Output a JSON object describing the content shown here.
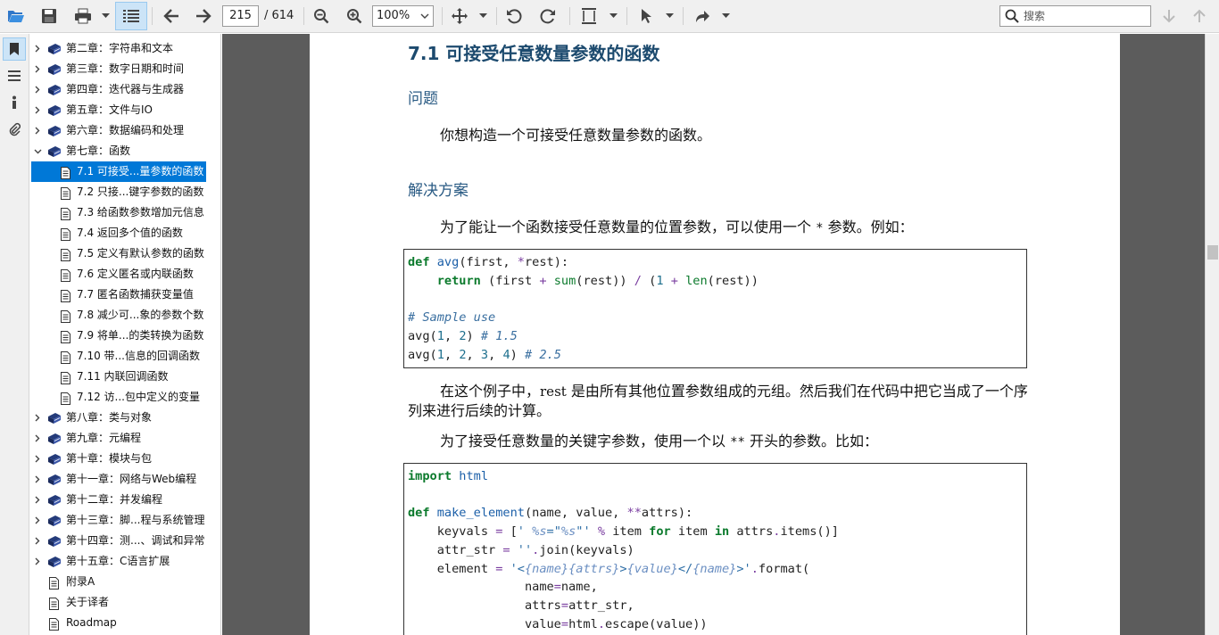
{
  "toolbar": {
    "page_current": "215",
    "page_total": "/ 614",
    "zoom_value": "100%",
    "search_placeholder": "搜索"
  },
  "sidebar": {
    "items": [
      {
        "label": "第二章：字符串和文本",
        "level": 0,
        "state": "collapsed"
      },
      {
        "label": "第三章：数字日期和时间",
        "level": 0,
        "state": "collapsed"
      },
      {
        "label": "第四章：迭代器与生成器",
        "level": 0,
        "state": "collapsed"
      },
      {
        "label": "第五章：文件与IO",
        "level": 0,
        "state": "collapsed"
      },
      {
        "label": "第六章：数据编码和处理",
        "level": 0,
        "state": "collapsed"
      },
      {
        "label": "第七章：函数",
        "level": 0,
        "state": "expanded"
      },
      {
        "label": "7.1 可接受...量参数的函数",
        "level": 1,
        "state": "selected"
      },
      {
        "label": "7.2 只接...键字参数的函数",
        "level": 1,
        "state": "leaf"
      },
      {
        "label": "7.3 给函数参数增加元信息",
        "level": 1,
        "state": "leaf"
      },
      {
        "label": "7.4 返回多个值的函数",
        "level": 1,
        "state": "leaf"
      },
      {
        "label": "7.5 定义有默认参数的函数",
        "level": 1,
        "state": "leaf"
      },
      {
        "label": "7.6 定义匿名或内联函数",
        "level": 1,
        "state": "leaf"
      },
      {
        "label": "7.7 匿名函数捕获变量值",
        "level": 1,
        "state": "leaf"
      },
      {
        "label": "7.8 减少可...象的参数个数",
        "level": 1,
        "state": "leaf"
      },
      {
        "label": "7.9 将单...的类转换为函数",
        "level": 1,
        "state": "leaf"
      },
      {
        "label": "7.10 带...信息的回调函数",
        "level": 1,
        "state": "leaf"
      },
      {
        "label": "7.11 内联回调函数",
        "level": 1,
        "state": "leaf"
      },
      {
        "label": "7.12 访...包中定义的变量",
        "level": 1,
        "state": "leaf"
      },
      {
        "label": "第八章：类与对象",
        "level": 0,
        "state": "collapsed"
      },
      {
        "label": "第九章：元编程",
        "level": 0,
        "state": "collapsed"
      },
      {
        "label": "第十章：模块与包",
        "level": 0,
        "state": "collapsed"
      },
      {
        "label": "第十一章：网络与Web编程",
        "level": 0,
        "state": "collapsed"
      },
      {
        "label": "第十二章：并发编程",
        "level": 0,
        "state": "collapsed"
      },
      {
        "label": "第十三章：脚...程与系统管理",
        "level": 0,
        "state": "collapsed"
      },
      {
        "label": "第十四章：测...、调试和异常",
        "level": 0,
        "state": "collapsed"
      },
      {
        "label": "第十五章：C语言扩展",
        "level": 0,
        "state": "collapsed"
      },
      {
        "label": "附录A",
        "level": 0,
        "state": "page"
      },
      {
        "label": "关于译者",
        "level": 0,
        "state": "page"
      },
      {
        "label": "Roadmap",
        "level": 0,
        "state": "page"
      }
    ]
  },
  "doc": {
    "title": "7.1 可接受任意数量参数的函数",
    "h_problem": "问题",
    "p_problem": "你想构造一个可接受任意数量参数的函数。",
    "h_solution": "解决方案",
    "p1_a": "为了能让一个函数接受任意数量的位置参数，可以使用一个 ",
    "p1_code": "*",
    "p1_b": " 参数。例如：",
    "p2_a": "在这个例子中，",
    "p2_code": "rest",
    "p2_b": " 是由所有其他位置参数组成的元组。然后我们在代码中把它当成了一个序列来进行后续的计算。",
    "p3_a": "为了接受任意数量的关键字参数，使用一个以 ",
    "p3_code": "**",
    "p3_b": " 开头的参数。比如："
  }
}
